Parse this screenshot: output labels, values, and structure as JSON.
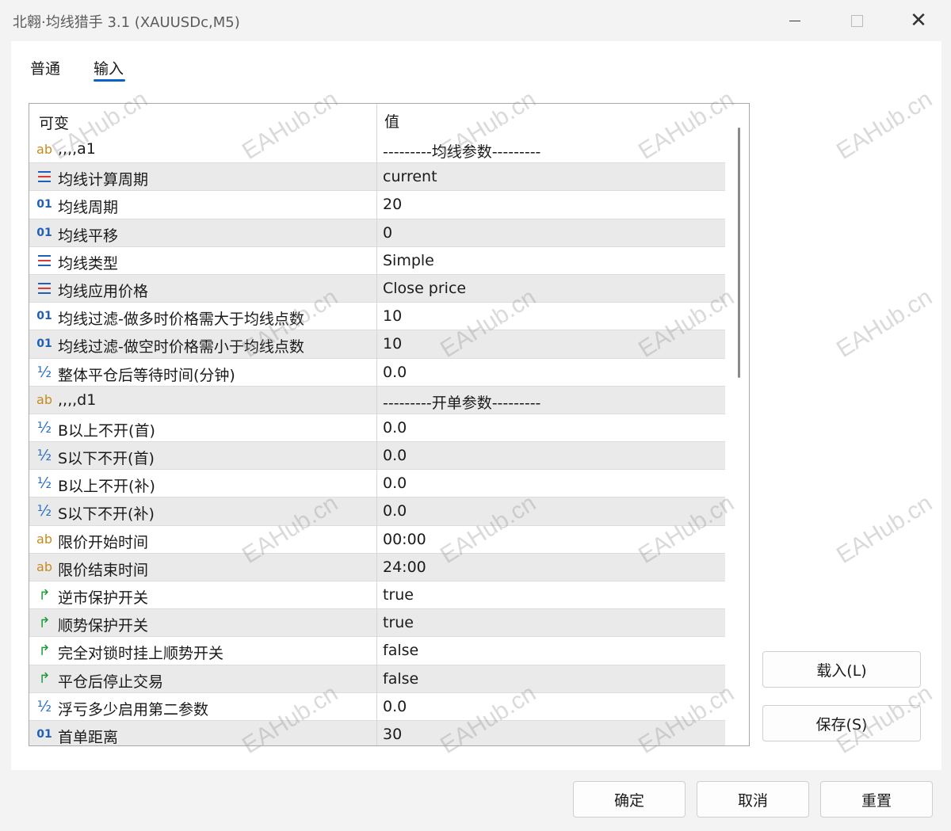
{
  "window": {
    "title": "北翱·均线猎手 3.1 (XAUUSDc,M5)"
  },
  "tabs": {
    "general": "普通",
    "inputs": "输入"
  },
  "grid": {
    "header_variable": "可变",
    "header_value": "值",
    "rows": [
      {
        "icon": "ab",
        "name": ",,,,a1",
        "value": "---------均线参数---------"
      },
      {
        "icon": "enum",
        "name": "均线计算周期",
        "value": "current"
      },
      {
        "icon": "int",
        "name": "均线周期",
        "value": "20"
      },
      {
        "icon": "int",
        "name": "均线平移",
        "value": "0"
      },
      {
        "icon": "enum",
        "name": "均线类型",
        "value": "Simple"
      },
      {
        "icon": "enum",
        "name": "均线应用价格",
        "value": "Close price"
      },
      {
        "icon": "int",
        "name": "均线过滤-做多时价格需大于均线点数",
        "value": "10"
      },
      {
        "icon": "int",
        "name": "均线过滤-做空时价格需小于均线点数",
        "value": "10"
      },
      {
        "icon": "double",
        "name": "整体平仓后等待时间(分钟)",
        "value": "0.0"
      },
      {
        "icon": "ab",
        "name": ",,,,d1",
        "value": "---------开单参数---------"
      },
      {
        "icon": "double",
        "name": "B以上不开(首)",
        "value": "0.0"
      },
      {
        "icon": "double",
        "name": "S以下不开(首)",
        "value": "0.0"
      },
      {
        "icon": "double",
        "name": "B以上不开(补)",
        "value": "0.0"
      },
      {
        "icon": "double",
        "name": "S以下不开(补)",
        "value": "0.0"
      },
      {
        "icon": "ab",
        "name": "限价开始时间",
        "value": "00:00"
      },
      {
        "icon": "ab",
        "name": "限价结束时间",
        "value": "24:00"
      },
      {
        "icon": "bool",
        "name": "逆市保护开关",
        "value": "true"
      },
      {
        "icon": "bool",
        "name": "顺势保护开关",
        "value": "true"
      },
      {
        "icon": "bool",
        "name": "完全对锁时挂上顺势开关",
        "value": "false"
      },
      {
        "icon": "bool",
        "name": "平仓后停止交易",
        "value": "false"
      },
      {
        "icon": "double",
        "name": "浮亏多少启用第二参数",
        "value": "0.0"
      },
      {
        "icon": "int",
        "name": "首单距离",
        "value": "30"
      }
    ]
  },
  "buttons": {
    "load": "载入(L)",
    "save": "保存(S)",
    "ok": "确定",
    "cancel": "取消",
    "reset": "重置"
  },
  "icon_glyphs": {
    "ab": "ab",
    "int": "01",
    "double": "½",
    "bool": "↱"
  },
  "watermark": "EAHub.cn"
}
